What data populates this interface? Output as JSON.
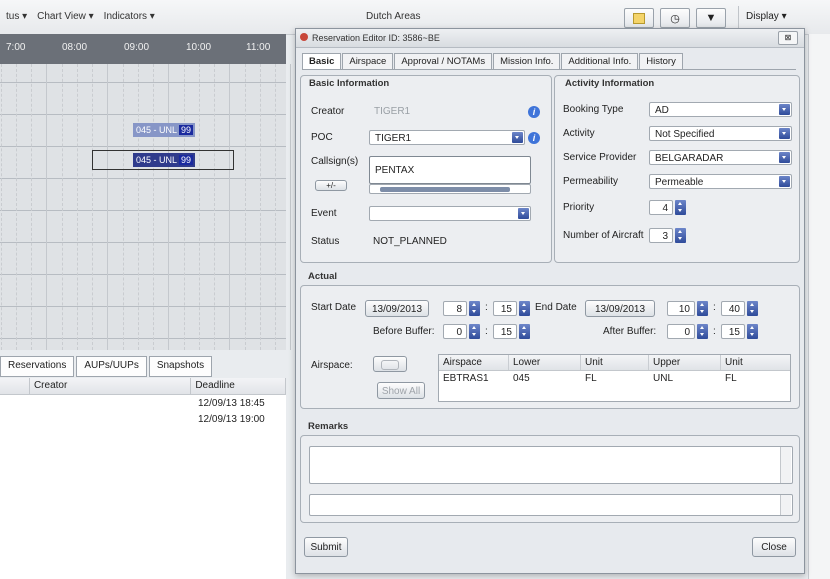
{
  "background": {
    "menu": [
      "tus ▾",
      "Chart View ▾",
      "Indicators ▾"
    ],
    "center_title": "Dutch Areas",
    "display_label": "Display ▾",
    "times": [
      "7:00",
      "08:00",
      "09:00",
      "10:00",
      "11:00"
    ],
    "bar1_label": "045 - UNL",
    "bar1_num": "99",
    "bar2_label": "045 - UNL",
    "bar2_num": "99",
    "bottom_tabs": [
      "Reservations",
      "AUPs/UUPs",
      "Snapshots"
    ],
    "columns": [
      "Creator",
      "Deadline"
    ],
    "rows": [
      "12/09/13 18:45",
      "12/09/13 19:00"
    ]
  },
  "dialog": {
    "title": "Reservation Editor ID: 3586~BE",
    "close_glyph": "⊠",
    "tabs": [
      "Basic",
      "Airspace",
      "Approval / NOTAMs",
      "Mission Info.",
      "Additional Info.",
      "History"
    ],
    "basic": {
      "group_label": "Basic Information",
      "creator_label": "Creator",
      "creator_value": "TIGER1",
      "poc_label": "POC",
      "poc_value": "TIGER1",
      "callsigns_label": "Callsign(s)",
      "callsign_value": "PENTAX",
      "plusminus_label": "+/-",
      "event_label": "Event",
      "event_value": "",
      "status_label": "Status",
      "status_value": "NOT_PLANNED",
      "info_glyph": "i"
    },
    "activity": {
      "group_label": "Activity Information",
      "booking_type_label": "Booking Type",
      "booking_type_value": "AD",
      "activity_label": "Activity",
      "activity_value": "Not Specified",
      "service_provider_label": "Service Provider",
      "service_provider_value": "BELGARADAR",
      "permeability_label": "Permeability",
      "permeability_value": "Permeable",
      "priority_label": "Priority",
      "priority_value": "4",
      "aircraft_label": "Number of Aircraft",
      "aircraft_value": "3"
    },
    "actual": {
      "group_label": "Actual",
      "start_date_label": "Start Date",
      "start_date_value": "13/09/2013",
      "start_hour": "8",
      "start_min": "15",
      "end_date_label": "End Date",
      "end_date_value": "13/09/2013",
      "end_hour": "10",
      "end_min": "40",
      "before_buffer_label": "Before Buffer:",
      "before_h": "0",
      "before_m": "15",
      "after_buffer_label": "After Buffer:",
      "after_h": "0",
      "after_m": "15",
      "colon": ":",
      "airspace_label": "Airspace:",
      "show_all_label": "Show All",
      "table_headers": [
        "Airspace",
        "Lower",
        "Unit",
        "Upper",
        "Unit"
      ],
      "table_row": [
        "EBTRAS1",
        "045",
        "FL",
        "UNL",
        "FL"
      ]
    },
    "remarks": {
      "group_label": "Remarks"
    },
    "submit_label": "Submit",
    "close_label": "Close"
  }
}
